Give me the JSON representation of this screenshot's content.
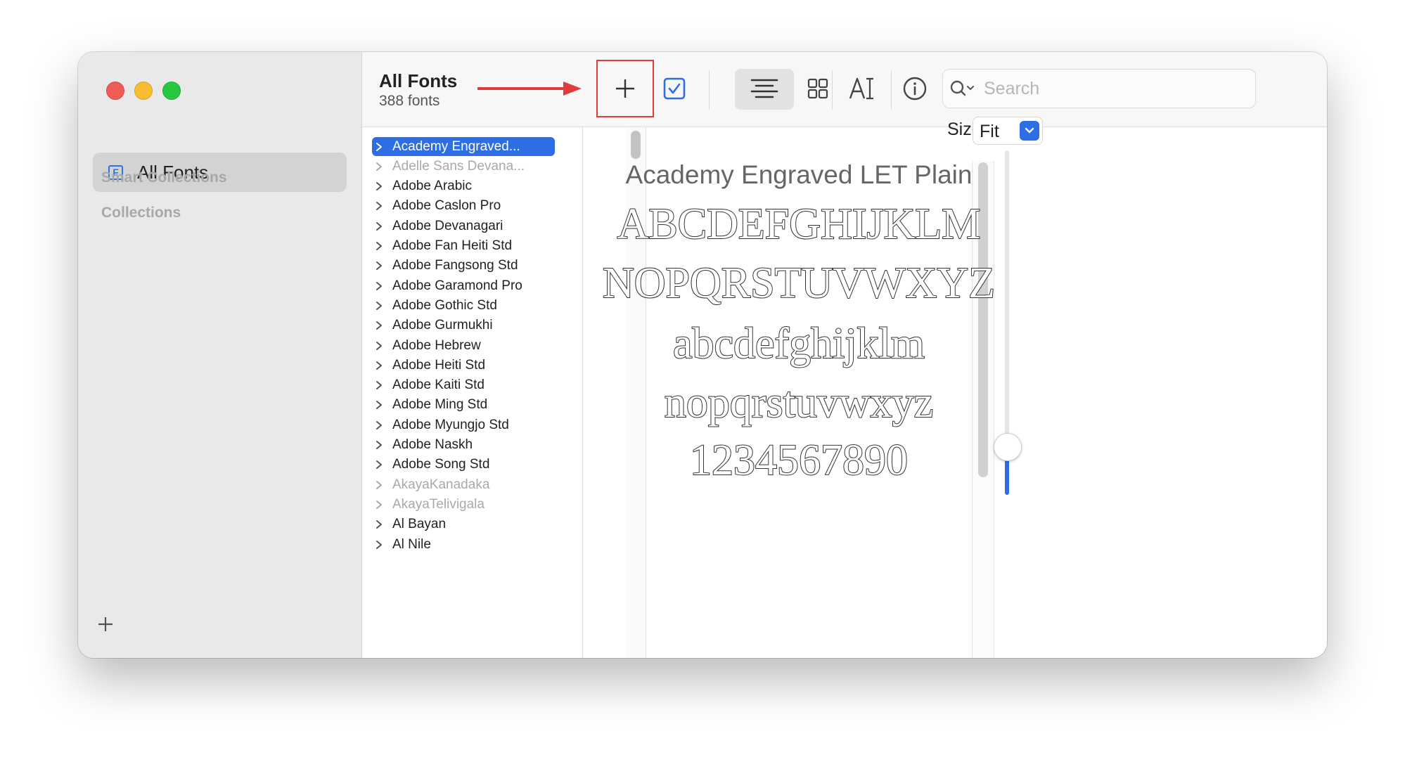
{
  "sidebar": {
    "all_fonts_label": "All Fonts",
    "all_fonts_icon_letter": "F",
    "smart_collections": "Smart Collections",
    "collections": "Collections",
    "add_label": "+"
  },
  "toolbar": {
    "title": "All Fonts",
    "subtitle": "388 fonts",
    "add_icon": "plus-icon",
    "search_placeholder": "Search",
    "annotation_color": "#e23b3b"
  },
  "font_list": [
    {
      "name": "Academy Engraved...",
      "state": "selected"
    },
    {
      "name": "Adelle Sans Devana...",
      "state": "dim"
    },
    {
      "name": "Adobe Arabic",
      "state": "normal"
    },
    {
      "name": "Adobe Caslon Pro",
      "state": "normal"
    },
    {
      "name": "Adobe Devanagari",
      "state": "normal"
    },
    {
      "name": "Adobe Fan Heiti Std",
      "state": "normal"
    },
    {
      "name": "Adobe Fangsong Std",
      "state": "normal"
    },
    {
      "name": "Adobe Garamond Pro",
      "state": "normal"
    },
    {
      "name": "Adobe Gothic Std",
      "state": "normal"
    },
    {
      "name": "Adobe Gurmukhi",
      "state": "normal"
    },
    {
      "name": "Adobe Hebrew",
      "state": "normal"
    },
    {
      "name": "Adobe Heiti Std",
      "state": "normal"
    },
    {
      "name": "Adobe Kaiti Std",
      "state": "normal"
    },
    {
      "name": "Adobe Ming Std",
      "state": "normal"
    },
    {
      "name": "Adobe Myungjo Std",
      "state": "normal"
    },
    {
      "name": "Adobe Naskh",
      "state": "normal"
    },
    {
      "name": "Adobe Song Std",
      "state": "normal"
    },
    {
      "name": "AkayaKanadaka",
      "state": "dim"
    },
    {
      "name": "AkayaTelivigala",
      "state": "dim"
    },
    {
      "name": "Al Bayan",
      "state": "normal"
    },
    {
      "name": "Al Nile",
      "state": "normal"
    }
  ],
  "preview": {
    "size_label": "Size:",
    "size_value": "Fit",
    "font_name": "Academy Engraved LET Plain",
    "line1": "ABCDEFGHIJKLM",
    "line2": "NOPQRSTUVWXYZ",
    "line3": "abcdefghijklm",
    "line4": "nopqrstuvwxyz",
    "line5": "1234567890",
    "size_slider_value": 0.14
  },
  "colors": {
    "accent": "#2d6ee5",
    "red": "#ee5d55",
    "yellow": "#f5bd2f",
    "green": "#28c740"
  }
}
